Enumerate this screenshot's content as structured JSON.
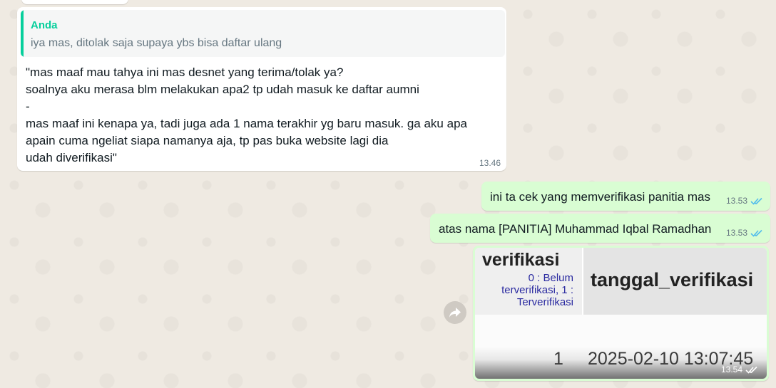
{
  "incoming": {
    "quote_author": "Anda",
    "quote_text": "iya mas, ditolak saja supaya ybs bisa daftar ulang",
    "text": "\"mas maaf mau tahya ini mas desnet yang terima/tolak ya?\nsoalnya aku merasa blm melakukan apa2 tp udah masuk ke daftar aumni\n-\nmas maaf ini kenapa ya, tadi juga ada 1 nama terakhir yg baru masuk. ga aku apa\napain cuma ngeliat siapa namanya aja, tp pas buka website lagi dia\nudah diverifikasi\"",
    "time": "13.46"
  },
  "outgoing": [
    {
      "text": "ini ta cek yang memverifikasi panitia mas",
      "time": "13.53",
      "status_icon": "double-check-icon"
    },
    {
      "text": "atas nama [PANITIA] Muhammad Iqbal Ramadhan",
      "time": "13.53",
      "status_icon": "double-check-icon"
    }
  ],
  "image_message": {
    "col1_header": "verifikasi",
    "col1_desc": "0 : Belum terverifikasi, 1 : Terverifikasi",
    "col2_header": "tanggal_verifikasi",
    "row_verifikasi": "1",
    "row_tanggal": "2025-02-10 13:07:45",
    "time": "13.54",
    "status_icon": "double-check-icon"
  },
  "colors": {
    "chat_background": "#efeae2",
    "incoming_bubble": "#ffffff",
    "outgoing_bubble": "#d9fdd3",
    "quote_accent": "#06cf9c",
    "read_ticks": "#53bdeb"
  }
}
